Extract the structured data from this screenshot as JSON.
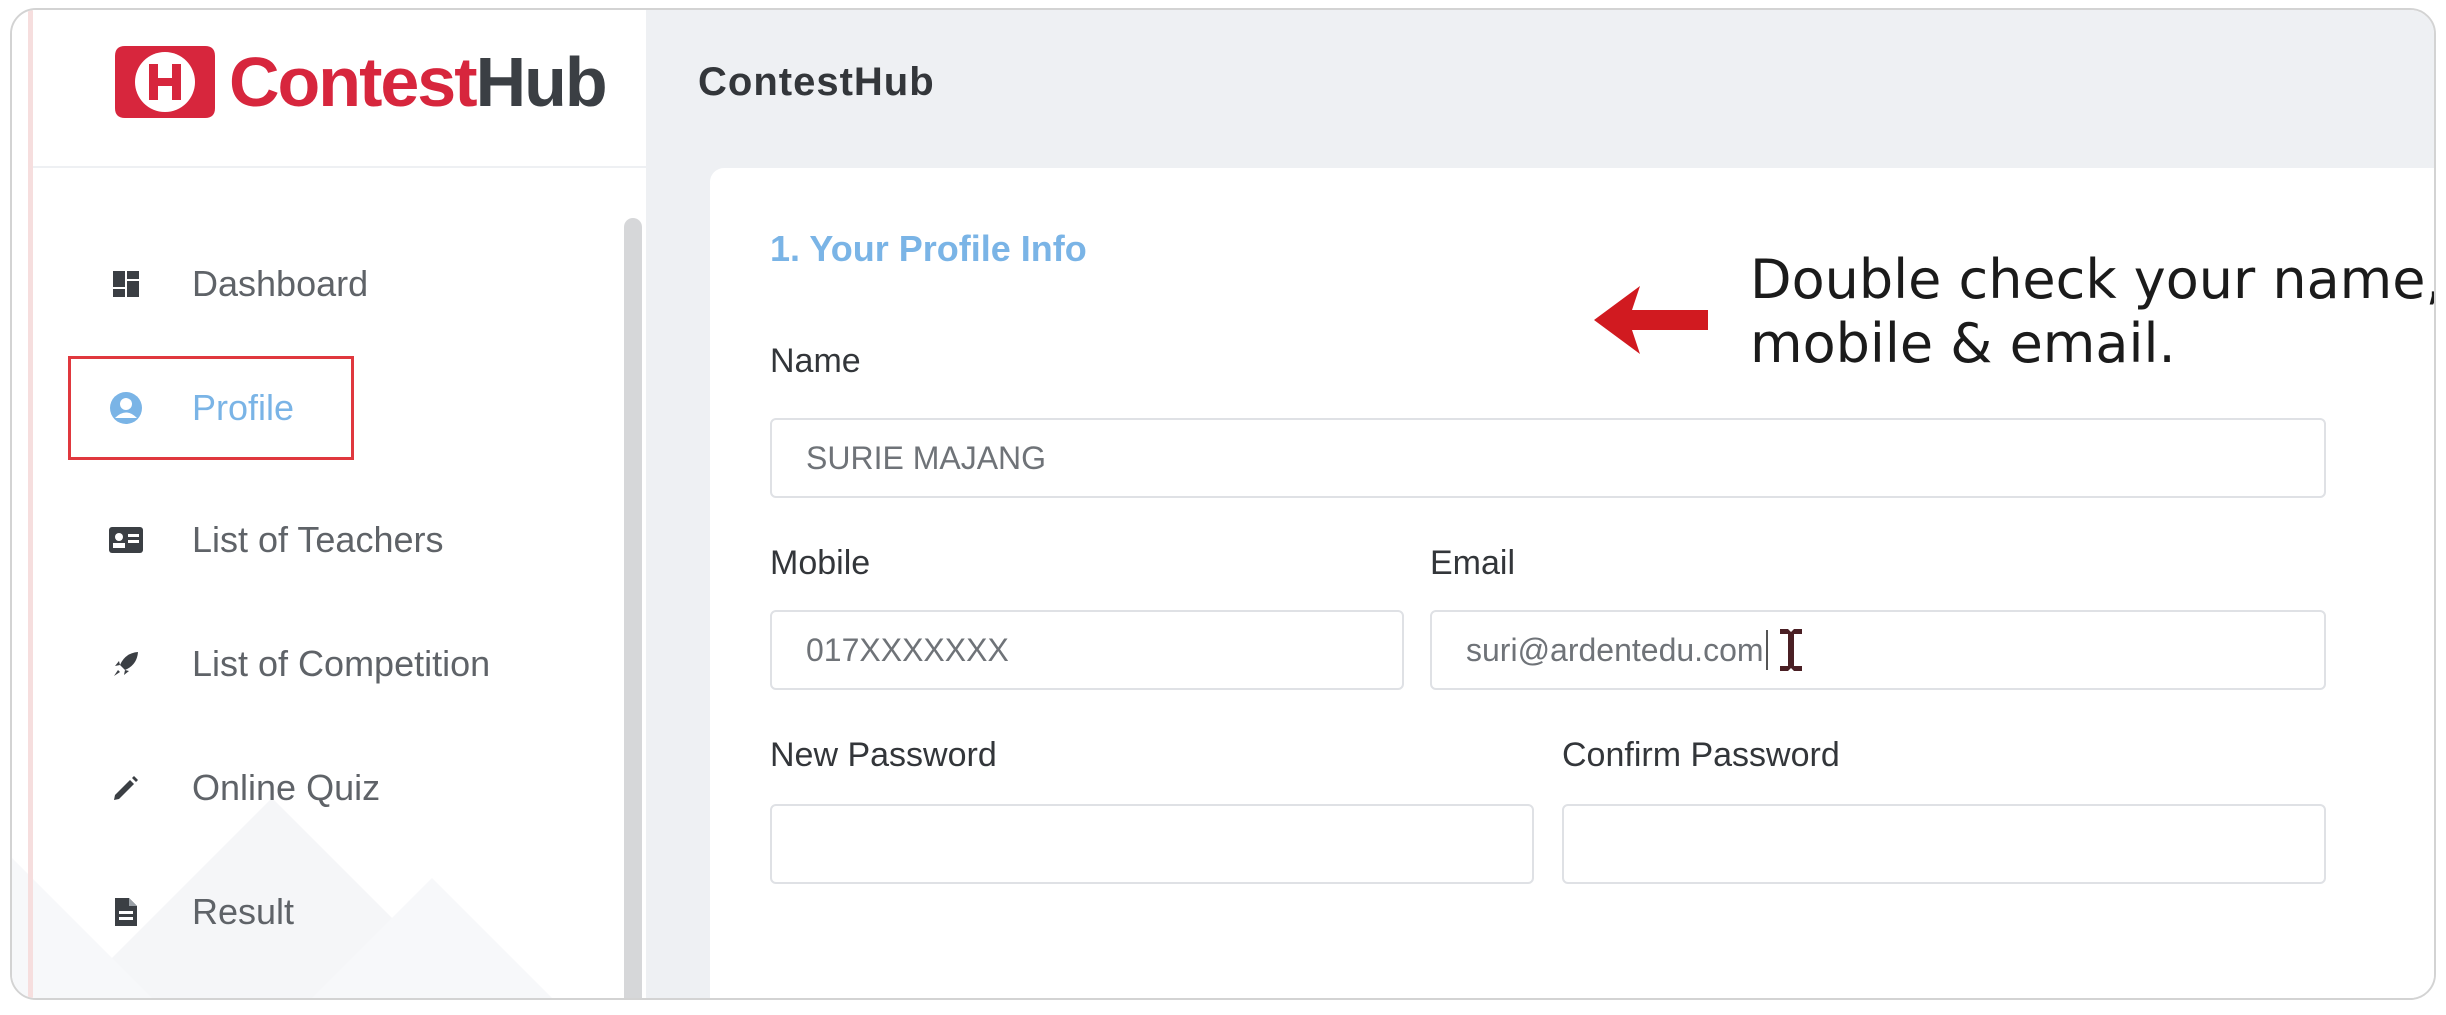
{
  "logo": {
    "part1": "Contest",
    "part2": "Hub"
  },
  "header": {
    "title": "ContestHub"
  },
  "sidebar": {
    "items": [
      {
        "label": "Dashboard",
        "icon": "dashboard-icon"
      },
      {
        "label": "Profile",
        "icon": "user-circle-icon",
        "active": true
      },
      {
        "label": "List of Teachers",
        "icon": "id-card-icon"
      },
      {
        "label": "List of Competition",
        "icon": "rocket-icon"
      },
      {
        "label": "Online Quiz",
        "icon": "pencil-icon"
      },
      {
        "label": "Result",
        "icon": "document-icon"
      }
    ]
  },
  "form": {
    "section_title": "1. Your Profile Info",
    "name": {
      "label": "Name",
      "value": "SURIE MAJANG"
    },
    "mobile": {
      "label": "Mobile",
      "value": "017XXXXXXX"
    },
    "email": {
      "label": "Email",
      "value": "suri@ardentedu.com"
    },
    "new_password": {
      "label": "New Password",
      "value": ""
    },
    "confirm_password": {
      "label": "Confirm Password",
      "value": ""
    }
  },
  "annotation": {
    "line1": "Double check your name,",
    "line2": "mobile & email."
  },
  "colors": {
    "brand_red": "#d7263d",
    "accent_blue": "#7ab4e6",
    "highlight_red": "#e0383e"
  }
}
